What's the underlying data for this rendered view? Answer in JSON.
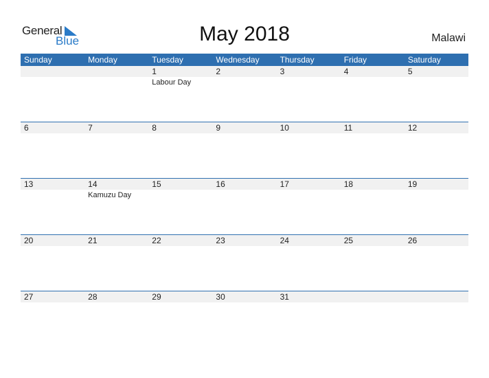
{
  "logo": {
    "word1": "General",
    "word2": "Blue"
  },
  "title": "May 2018",
  "country": "Malawi",
  "colors": {
    "accent": "#2e6fb0",
    "daybar": "#f1f1f1",
    "logo_blue": "#2a7bc8"
  },
  "weekdays": [
    "Sunday",
    "Monday",
    "Tuesday",
    "Wednesday",
    "Thursday",
    "Friday",
    "Saturday"
  ],
  "weeks": [
    {
      "days": [
        "",
        "",
        "1",
        "2",
        "3",
        "4",
        "5"
      ],
      "events": [
        "",
        "",
        "Labour Day",
        "",
        "",
        "",
        ""
      ]
    },
    {
      "days": [
        "6",
        "7",
        "8",
        "9",
        "10",
        "11",
        "12"
      ],
      "events": [
        "",
        "",
        "",
        "",
        "",
        "",
        ""
      ]
    },
    {
      "days": [
        "13",
        "14",
        "15",
        "16",
        "17",
        "18",
        "19"
      ],
      "events": [
        "",
        "Kamuzu Day",
        "",
        "",
        "",
        "",
        ""
      ]
    },
    {
      "days": [
        "20",
        "21",
        "22",
        "23",
        "24",
        "25",
        "26"
      ],
      "events": [
        "",
        "",
        "",
        "",
        "",
        "",
        ""
      ]
    },
    {
      "days": [
        "27",
        "28",
        "29",
        "30",
        "31",
        "",
        ""
      ],
      "events": [
        "",
        "",
        "",
        "",
        "",
        "",
        ""
      ]
    }
  ]
}
